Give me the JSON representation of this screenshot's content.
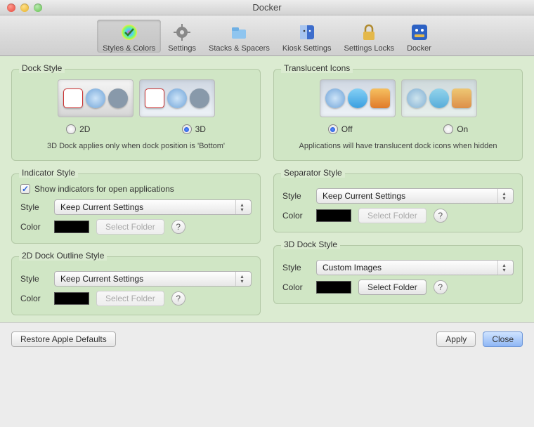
{
  "window": {
    "title": "Docker"
  },
  "toolbar": {
    "items": [
      {
        "label": "Styles & Colors",
        "icon": "color-wheel-icon",
        "selected": true
      },
      {
        "label": "Settings",
        "icon": "gear-icon",
        "selected": false
      },
      {
        "label": "Stacks & Spacers",
        "icon": "folder-icon",
        "selected": false
      },
      {
        "label": "Kiosk Settings",
        "icon": "finder-icon",
        "selected": false
      },
      {
        "label": "Settings Locks",
        "icon": "lock-icon",
        "selected": false
      },
      {
        "label": "Docker",
        "icon": "docker-app-icon",
        "selected": false
      }
    ]
  },
  "dock_style": {
    "title": "Dock Style",
    "option_2d": "2D",
    "option_3d": "3D",
    "selected": "3D",
    "hint": "3D Dock applies only when dock position is 'Bottom'"
  },
  "translucent": {
    "title": "Translucent Icons",
    "option_off": "Off",
    "option_on": "On",
    "selected": "Off",
    "hint": "Applications will have translucent dock icons when hidden"
  },
  "indicator": {
    "title": "Indicator Style",
    "checkbox_label": "Show indicators for open applications",
    "checkbox_checked": true,
    "style_label": "Style",
    "style_value": "Keep Current Settings",
    "color_label": "Color",
    "color_value": "#000000",
    "folder_button": "Select Folder",
    "folder_enabled": false
  },
  "separator": {
    "title": "Separator Style",
    "style_label": "Style",
    "style_value": "Keep Current Settings",
    "color_label": "Color",
    "color_value": "#000000",
    "folder_button": "Select Folder",
    "folder_enabled": false
  },
  "outline2d": {
    "title": "2D Dock Outline Style",
    "style_label": "Style",
    "style_value": "Keep Current Settings",
    "color_label": "Color",
    "color_value": "#000000",
    "folder_button": "Select Folder",
    "folder_enabled": false
  },
  "dock3d": {
    "title": "3D Dock Style",
    "style_label": "Style",
    "style_value": "Custom Images",
    "color_label": "Color",
    "color_value": "#000000",
    "folder_button": "Select Folder",
    "folder_enabled": true
  },
  "footer": {
    "restore": "Restore Apple Defaults",
    "apply": "Apply",
    "close": "Close"
  },
  "help": "?"
}
